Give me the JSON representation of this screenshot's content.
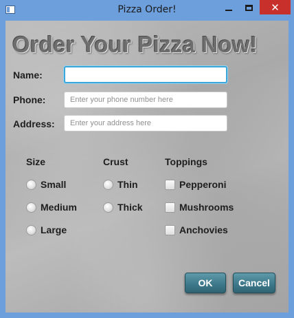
{
  "window": {
    "title": "Pizza Order!",
    "controls": {
      "minimize": "minimize",
      "maximize": "maximize",
      "close": "✕"
    },
    "accent_color": "#6d9fdc",
    "close_color": "#c7302b"
  },
  "form": {
    "heading": "Order Your Pizza Now!",
    "name": {
      "label": "Name:",
      "value": "",
      "placeholder": ""
    },
    "phone": {
      "label": "Phone:",
      "value": "",
      "placeholder": "Enter your phone number here"
    },
    "address": {
      "label": "Address:",
      "value": "",
      "placeholder": "Enter your address here"
    }
  },
  "size": {
    "title": "Size",
    "options": [
      {
        "label": "Small",
        "selected": false
      },
      {
        "label": "Medium",
        "selected": false
      },
      {
        "label": "Large",
        "selected": false
      }
    ]
  },
  "crust": {
    "title": "Crust",
    "options": [
      {
        "label": "Thin",
        "selected": false
      },
      {
        "label": "Thick",
        "selected": false
      }
    ]
  },
  "toppings": {
    "title": "Toppings",
    "options": [
      {
        "label": "Pepperoni",
        "checked": false
      },
      {
        "label": "Mushrooms",
        "checked": false
      },
      {
        "label": "Anchovies",
        "checked": false
      }
    ]
  },
  "buttons": {
    "ok": "OK",
    "cancel": "Cancel",
    "color": "#3e7a8b"
  }
}
